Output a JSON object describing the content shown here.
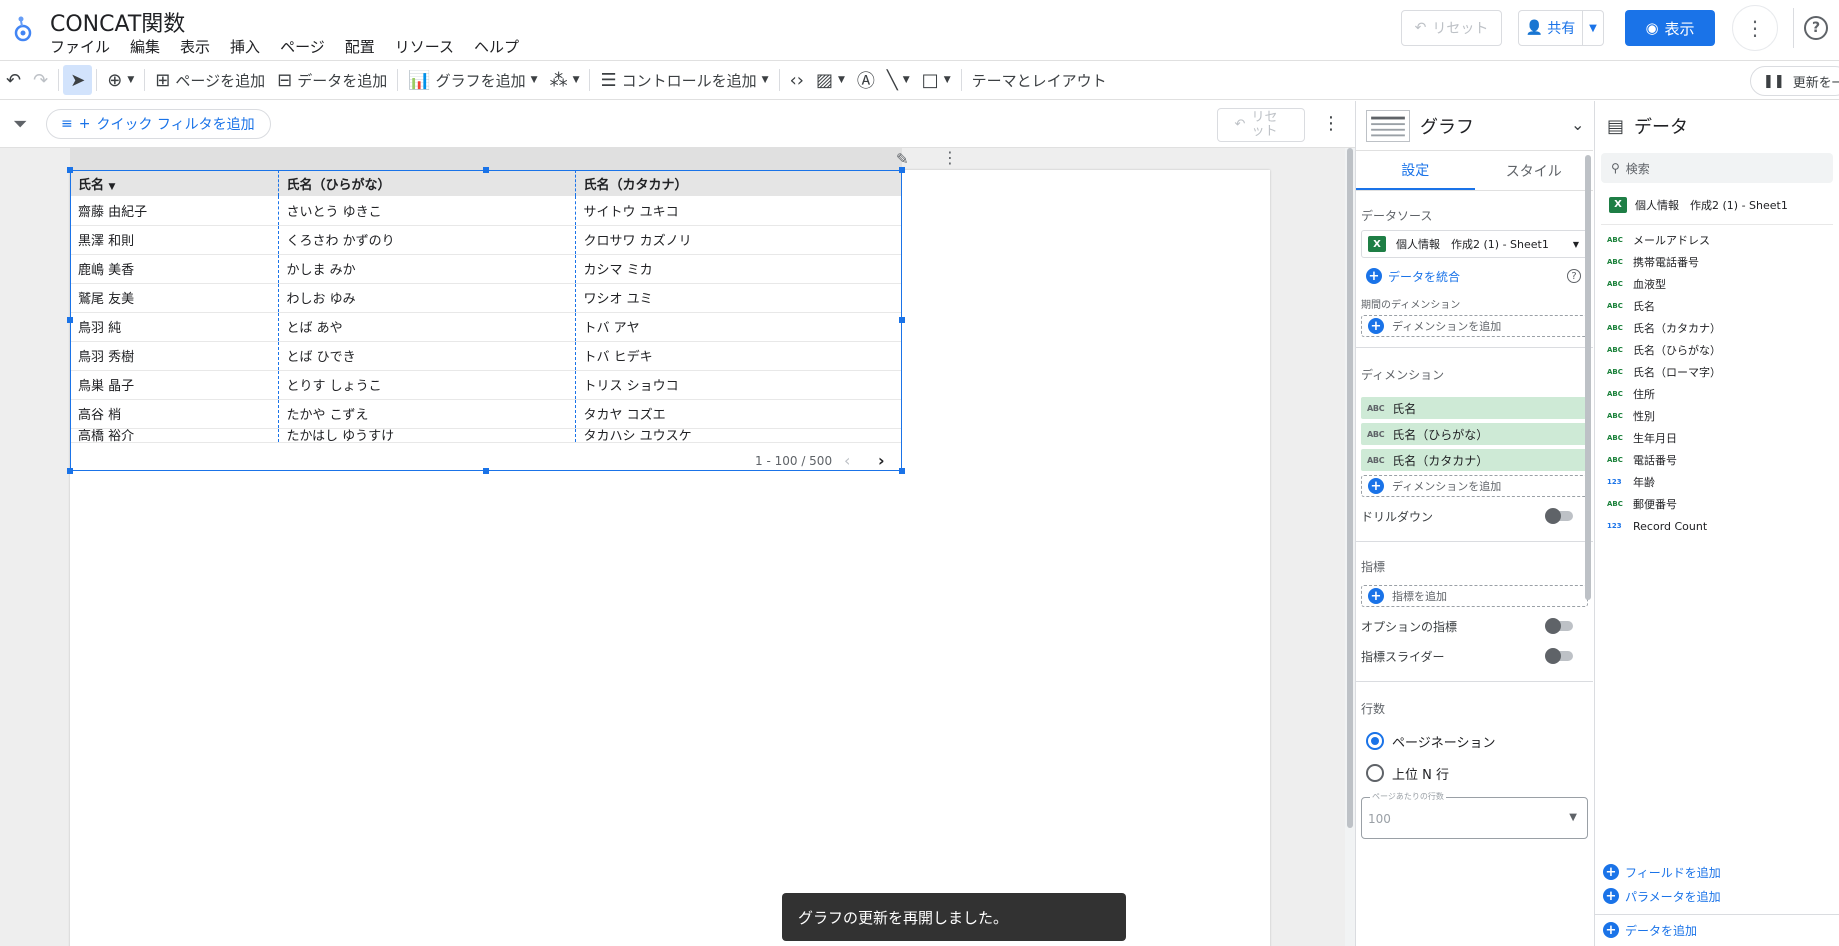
{
  "app": {
    "title": "CONCAT関数"
  },
  "menu": [
    "ファイル",
    "編集",
    "表示",
    "挿入",
    "ページ",
    "配置",
    "リソース",
    "ヘルプ"
  ],
  "header": {
    "reset_label": "リセット",
    "share_label": "共有",
    "view_label": "表示"
  },
  "toolbar": {
    "add_page": "ページを追加",
    "add_data": "データを追加",
    "add_chart": "グラフを追加",
    "add_control": "コントロールを追加",
    "theme_layout": "テーマとレイアウト",
    "refresh_label": "更新を一"
  },
  "filterbar": {
    "quick_filter": "クイック フィルタを追加",
    "reset_label": "リセ ット"
  },
  "table": {
    "columns": [
      "氏名",
      "氏名（ひらがな）",
      "氏名（カタカナ）"
    ],
    "rows": [
      [
        "齋藤 由紀子",
        "さいとう ゆきこ",
        "サイトウ ユキコ"
      ],
      [
        "黒澤 和則",
        "くろさわ かずのり",
        "クロサワ カズノリ"
      ],
      [
        "鹿嶋 美香",
        "かしま みか",
        "カシマ ミカ"
      ],
      [
        "鷲尾 友美",
        "わしお ゆみ",
        "ワシオ ユミ"
      ],
      [
        "鳥羽 純",
        "とば あや",
        "トバ アヤ"
      ],
      [
        "鳥羽 秀樹",
        "とば ひでき",
        "トバ ヒデキ"
      ],
      [
        "鳥巣 晶子",
        "とりす しょうこ",
        "トリス ショウコ"
      ],
      [
        "高谷 梢",
        "たかや こずえ",
        "タカヤ コズエ"
      ],
      [
        "高橋 裕介",
        "たかはし ゆうすけ",
        "タカハシ ユウスケ"
      ]
    ],
    "pager": "1 - 100 / 500"
  },
  "toast": "グラフの更新を再開しました。",
  "properties": {
    "title": "グラフ",
    "tabs": [
      "設定",
      "スタイル"
    ],
    "datasource_label": "データソース",
    "datasource_name": "個人情報　作成2 (1) - Sheet1",
    "blend_label": "データを統合",
    "period_dimension_label": "期間のディメンション",
    "add_dimension": "ディメンションを追加",
    "dimension_label": "ディメンション",
    "dimensions": [
      "氏名",
      "氏名（ひらがな）",
      "氏名（カタカナ）"
    ],
    "drilldown_label": "ドリルダウン",
    "metric_label": "指標",
    "add_metric": "指標を追加",
    "optional_metrics": "オプションの指標",
    "metric_slider": "指標スライダー",
    "rows_label": "行数",
    "pagination": "ページネーション",
    "top_n": "上位 N 行",
    "rows_per_page_label": "ページあたりの行数",
    "rows_per_page_value": "100"
  },
  "data_panel": {
    "title": "データ",
    "search_placeholder": "検索",
    "source": "個人情報　作成2 (1) - Sheet1",
    "fields": [
      {
        "type": "ABC",
        "name": "メールアドレス"
      },
      {
        "type": "ABC",
        "name": "携帯電話番号"
      },
      {
        "type": "ABC",
        "name": "血液型"
      },
      {
        "type": "ABC",
        "name": "氏名"
      },
      {
        "type": "ABC",
        "name": "氏名（カタカナ）"
      },
      {
        "type": "ABC",
        "name": "氏名（ひらがな）"
      },
      {
        "type": "ABC",
        "name": "氏名（ローマ字）"
      },
      {
        "type": "ABC",
        "name": "住所"
      },
      {
        "type": "ABC",
        "name": "性別"
      },
      {
        "type": "ABC",
        "name": "生年月日"
      },
      {
        "type": "ABC",
        "name": "電話番号"
      },
      {
        "type": "123",
        "name": "年齢"
      },
      {
        "type": "ABC",
        "name": "郵便番号"
      },
      {
        "type": "123",
        "name": "Record Count"
      }
    ],
    "add_field": "フィールドを追加",
    "add_parameter": "パラメータを追加",
    "add_data": "データを追加"
  },
  "colors": {
    "accent": "#1a73e8",
    "dimension_chip": "#ceead6",
    "excel": "#1e7e45"
  }
}
